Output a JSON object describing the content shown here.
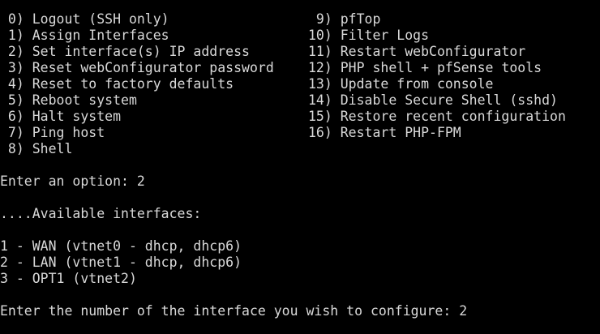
{
  "colors": {
    "background": "#000000",
    "text": "#d9d9d9"
  },
  "menu": {
    "left": [
      " 0) Logout (SSH only)",
      " 1) Assign Interfaces",
      " 2) Set interface(s) IP address",
      " 3) Reset webConfigurator password",
      " 4) Reset to factory defaults",
      " 5) Reboot system",
      " 6) Halt system",
      " 7) Ping host",
      " 8) Shell"
    ],
    "right": [
      " 9) pfTop",
      "10) Filter Logs",
      "11) Restart webConfigurator",
      "12) PHP shell + pfSense tools",
      "13) Update from console",
      "14) Disable Secure Shell (sshd)",
      "15) Restore recent configuration",
      "16) Restart PHP-FPM"
    ]
  },
  "session": {
    "option_prompt": "Enter an option: 2",
    "available_header": "....Available interfaces:",
    "interfaces": [
      "1 - WAN (vtnet0 - dhcp, dhcp6)",
      "2 - LAN (vtnet1 - dhcp, dhcp6)",
      "3 - OPT1 (vtnet2)"
    ],
    "configure_prompt": "Enter the number of the interface you wish to configure: 2"
  }
}
